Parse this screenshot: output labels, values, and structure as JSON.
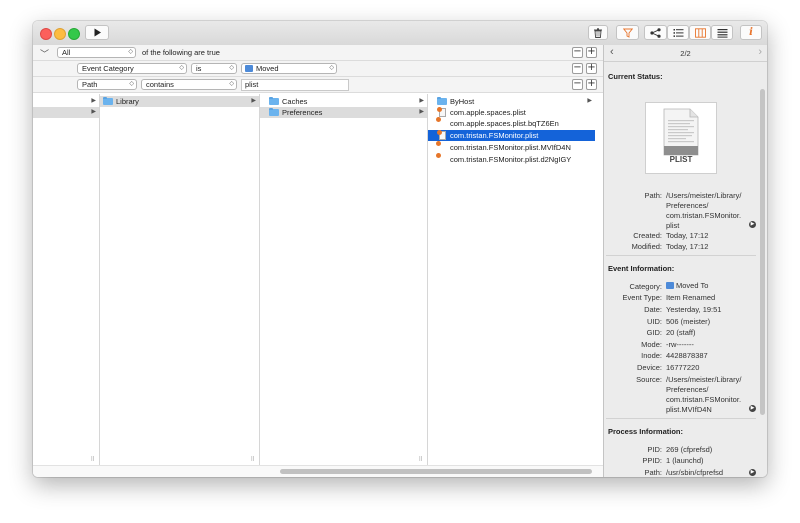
{
  "predicates": {
    "match": "All",
    "match_suffix": "of the following are true",
    "row1": {
      "field": "Event Category",
      "operator": "is",
      "value": "Moved"
    },
    "row2": {
      "field": "Path",
      "operator": "contains",
      "value": "plist"
    }
  },
  "columns": {
    "col2": [
      "Library"
    ],
    "col3": [
      "Caches",
      "Preferences"
    ],
    "col4": [
      "ByHost",
      "com.apple.spaces.plist",
      "com.apple.spaces.plist.bqTZ6En",
      "com.tristan.FSMonitor.plist",
      "com.tristan.FSMonitor.plist.MVIfD4N",
      "com.tristan.FSMonitor.plist.d2NgIGY"
    ]
  },
  "inspector": {
    "page": "2/2",
    "current_status": {
      "heading": "Current Status:",
      "icon_label": "PLIST",
      "path_label": "Path:",
      "path_value": "/Users/meister/Library/ Preferences/ com.tristan.FSMonitor. plist",
      "created_label": "Created:",
      "created_value": "Today, 17:12",
      "modified_label": "Modified:",
      "modified_value": "Today, 17:12"
    },
    "event_information": {
      "heading": "Event Information:",
      "category_label": "Category:",
      "category_value": "Moved To",
      "event_type_label": "Event Type:",
      "event_type_value": "Item Renamed",
      "date_label": "Date:",
      "date_value": "Yesterday, 19:51",
      "uid_label": "UID:",
      "uid_value": "506 (meister)",
      "gid_label": "GID:",
      "gid_value": "20 (staff)",
      "mode_label": "Mode:",
      "mode_value": "-rw-------",
      "inode_label": "Inode:",
      "inode_value": "4428878387",
      "device_label": "Device:",
      "device_value": "16777220",
      "source_label": "Source:",
      "source_value": "/Users/meister/Library/ Preferences/ com.tristan.FSMonitor. plist.MVIfD4N"
    },
    "process_information": {
      "heading": "Process Information:",
      "pid_label": "PID:",
      "pid_value": "269 (cfprefsd)",
      "ppid_label": "PPID:",
      "ppid_value": "1 (launchd)",
      "path_label": "Path:",
      "path_value": "/usr/sbin/cfprefsd"
    }
  },
  "icons": {
    "toolbar": [
      "play-icon",
      "trash-icon",
      "filter-icon",
      "share-icon",
      "list-icon",
      "columns-icon",
      "rows-icon",
      "info-icon"
    ],
    "info_text": "i"
  },
  "colors": {
    "selection_blue": "#1463d9",
    "folder_blue": "#6bb3ee",
    "filter_orange": "#e8742c",
    "info_orange": "#e8742c"
  }
}
